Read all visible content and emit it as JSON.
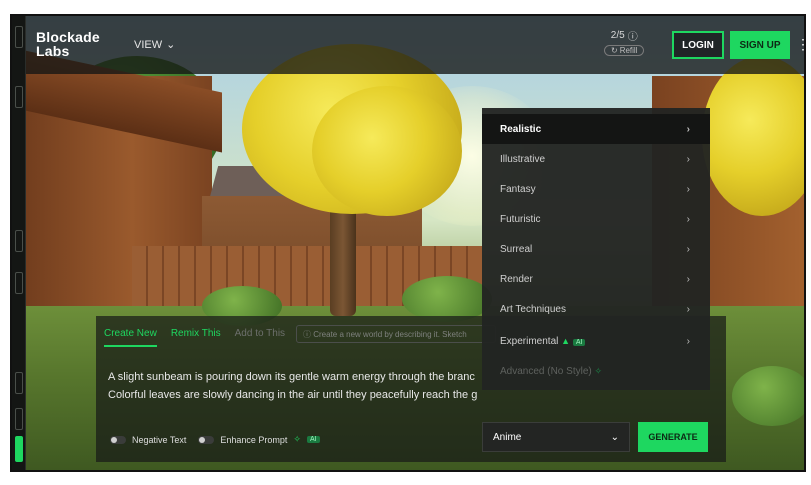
{
  "brand": {
    "name_line1": "Blockade",
    "name_line2": "Labs"
  },
  "header": {
    "view_label": "VIEW",
    "credits": "2/5",
    "refill_label": "Refill",
    "login_label": "LOGIN",
    "signup_label": "SIGN UP"
  },
  "prompt_panel": {
    "tabs": [
      {
        "label": "Create New"
      },
      {
        "label": "Remix This"
      },
      {
        "label": "Add to This"
      }
    ],
    "hint": "Create a new world by describing it. Sketch",
    "prompt_line1": "A slight sunbeam is pouring down its gentle warm energy through the branc",
    "prompt_line2": "Colorful leaves are slowly dancing in the air until they peacefully reach the g",
    "negative_text_label": "Negative Text",
    "enhance_prompt_label": "Enhance Prompt",
    "enhance_badge": "AI"
  },
  "style_menu": {
    "items": [
      {
        "label": "Realistic"
      },
      {
        "label": "Illustrative"
      },
      {
        "label": "Fantasy"
      },
      {
        "label": "Futuristic"
      },
      {
        "label": "Surreal"
      },
      {
        "label": "Render"
      },
      {
        "label": "Art Techniques"
      },
      {
        "label": "Experimental"
      },
      {
        "label": "Advanced (No Style)"
      }
    ],
    "experimental_badge": "AI"
  },
  "style_select": {
    "value": "Anime"
  },
  "generate_label": "GENERATE",
  "colors": {
    "accent": "#1ed760",
    "panel": "#222422"
  }
}
